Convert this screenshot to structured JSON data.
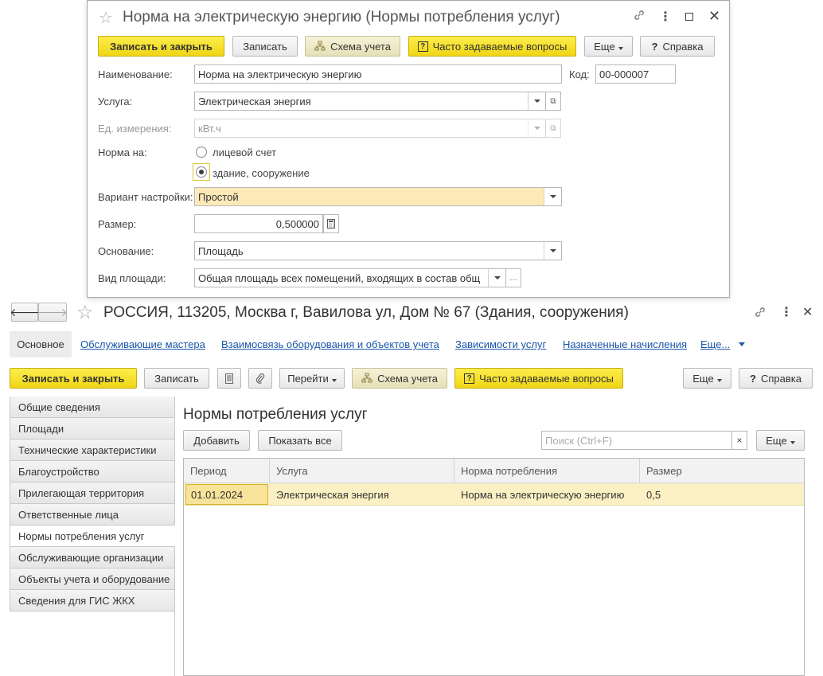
{
  "dialog": {
    "title": "Норма на электрическую энергию (Нормы потребления услуг)",
    "toolbar": {
      "save_close": "Записать и закрыть",
      "save": "Записать",
      "scheme": "Схема учета",
      "faq": "Часто задаваемые вопросы",
      "more": "Еще",
      "help": "Справка"
    },
    "fields": {
      "name_label": "Наименование:",
      "name_value": "Норма на электрическую энергию",
      "code_label": "Код:",
      "code_value": "00-000007",
      "service_label": "Услуга:",
      "service_value": "Электрическая энергия",
      "unit_label": "Ед. измерения:",
      "unit_value": "кВт.ч",
      "norm_label": "Норма на:",
      "norm_option1": "лицевой счет",
      "norm_option2": "здание, сооружение",
      "variant_label": "Вариант настройки:",
      "variant_value": "Простой",
      "size_label": "Размер:",
      "size_value": "0,500000",
      "basis_label": "Основание:",
      "basis_value": "Площадь",
      "area_label": "Вид площади:",
      "area_value": "Общая площадь всех помещений, входящих в состав общ"
    }
  },
  "main": {
    "title": "РОССИЯ, 113205, Москва г, Вавилова ул, Дом № 67 (Здания, сооружения)",
    "nav": {
      "active": "Основное",
      "links": [
        "Обслуживающие мастера",
        "Взаимосвязь оборудования и объектов учета",
        "Зависимости услуг",
        "Назначенные начисления"
      ],
      "more": "Еще..."
    },
    "toolbar": {
      "save_close": "Записать и закрыть",
      "save": "Записать",
      "goto": "Перейти",
      "scheme": "Схема учета",
      "faq": "Часто задаваемые вопросы",
      "more": "Еще",
      "help": "Справка"
    },
    "sidebar": [
      "Общие сведения",
      "Площади",
      "Технические характеристики",
      "Благоустройство",
      "Прилегающая территория",
      "Ответственные лица",
      "Нормы потребления услуг",
      "Обслуживающие организации",
      "Объекты учета и оборудование",
      "Сведения для ГИС ЖКХ"
    ],
    "section": {
      "title": "Нормы потребления услуг",
      "add": "Добавить",
      "show_all": "Показать все",
      "search_placeholder": "Поиск (Ctrl+F)",
      "more": "Еще"
    },
    "table": {
      "headers": [
        "Период",
        "Услуга",
        "Норма потребления",
        "Размер"
      ],
      "rows": [
        [
          "01.01.2024",
          "Электрическая энергия",
          "Норма на электрическую энергию",
          "0,5"
        ]
      ]
    }
  }
}
